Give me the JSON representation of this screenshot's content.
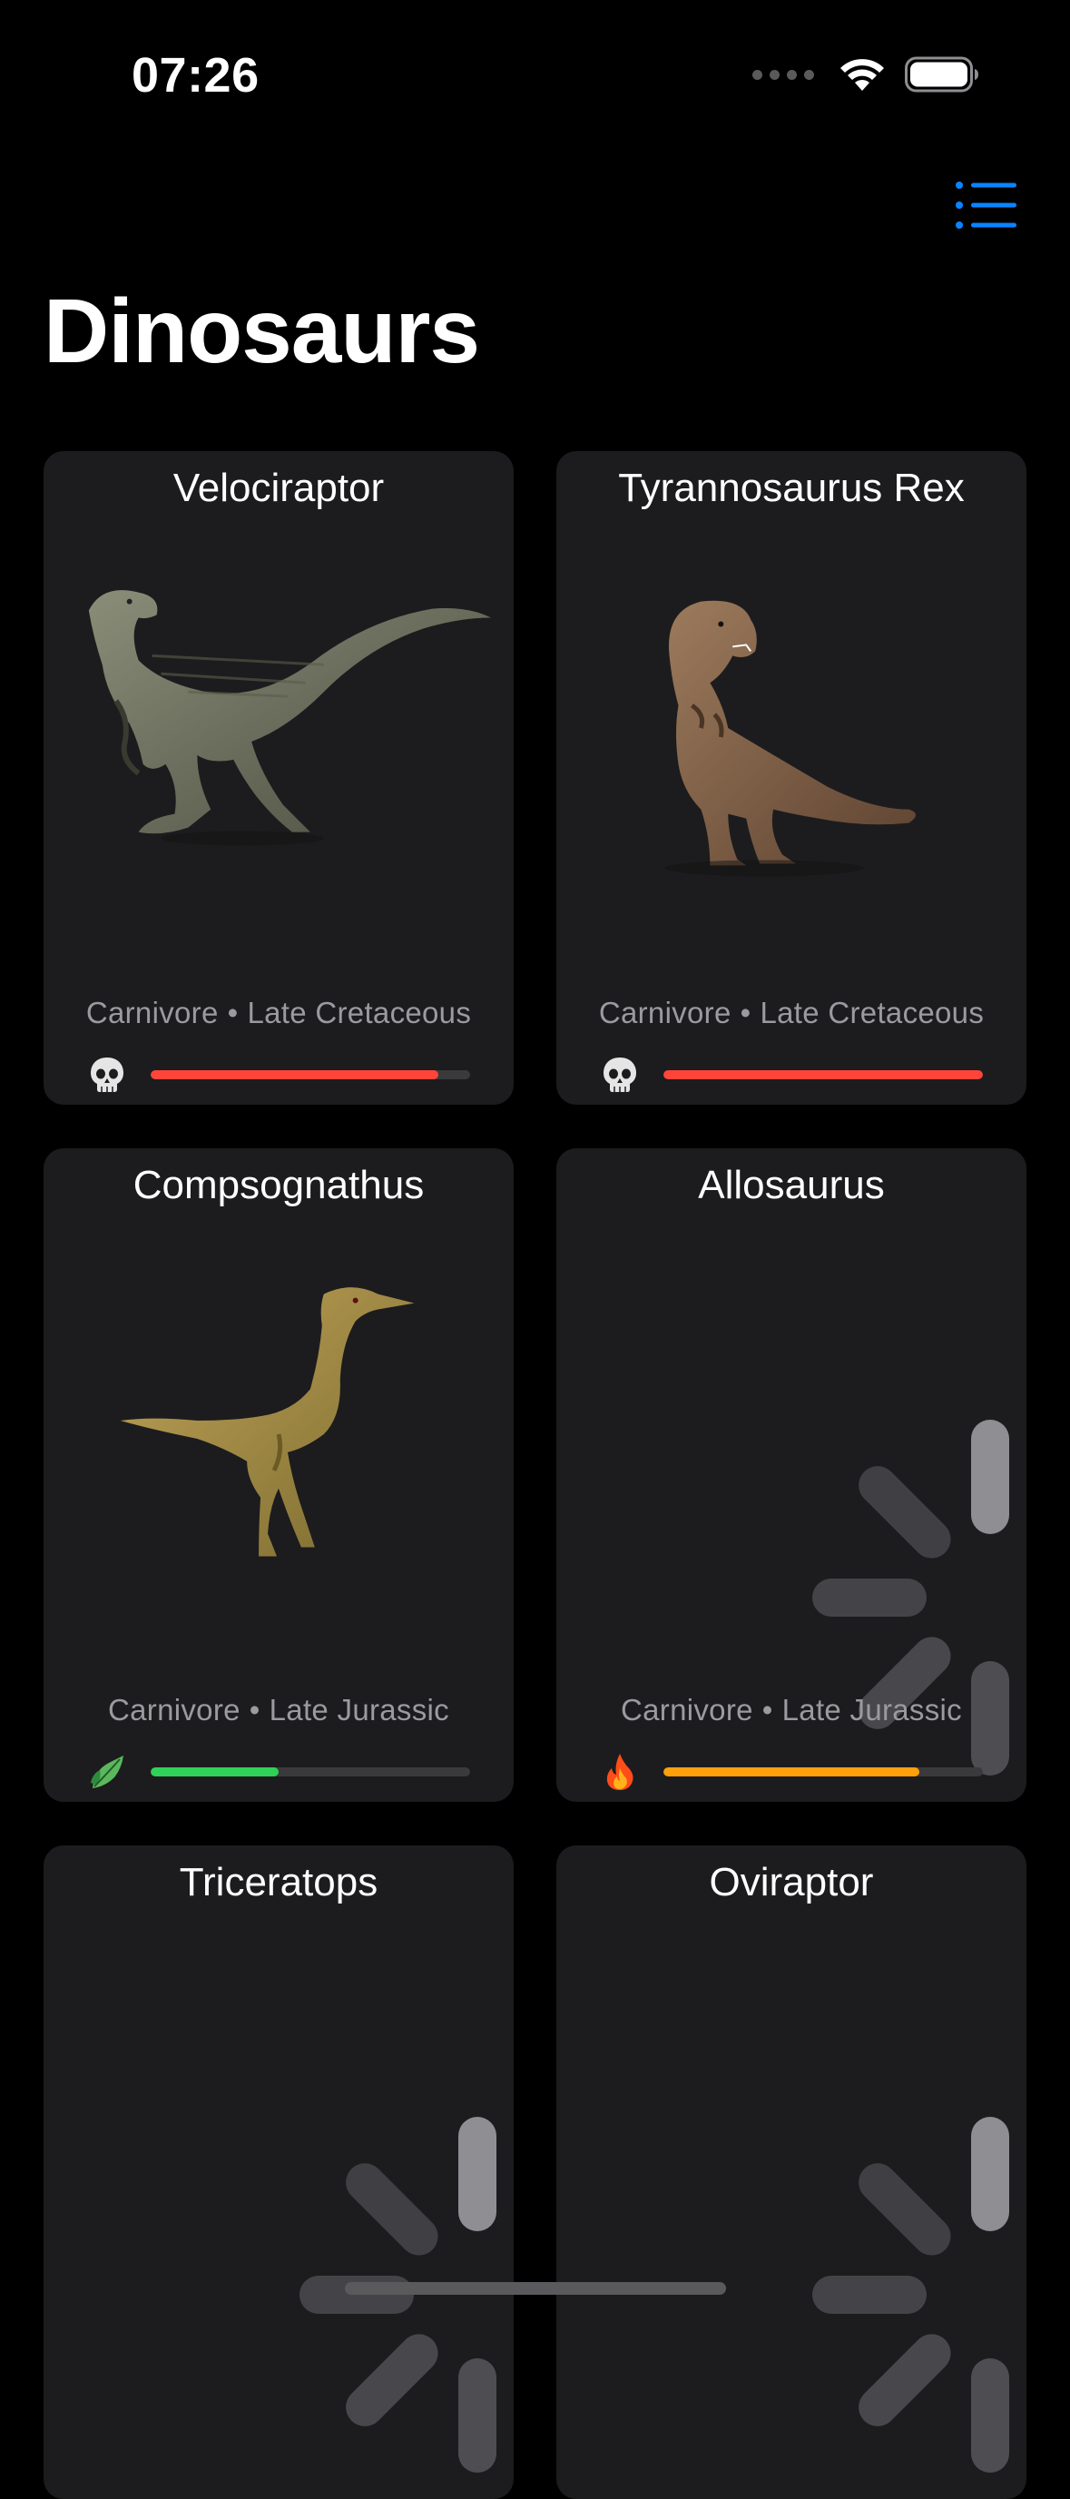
{
  "status_bar": {
    "time": "07:26"
  },
  "header": {
    "title": "Dinosaurs",
    "menu_icon": "list-icon",
    "accent_color": "#0a84ff"
  },
  "dinosaurs": [
    {
      "name": "Velociraptor",
      "diet": "Carnivore",
      "period": "Late Cretaceous",
      "status_icon": "skull-icon",
      "level": 0.9,
      "bar_color": "#ff453a",
      "image": "velociraptor-image"
    },
    {
      "name": "Tyrannosaurus Rex",
      "diet": "Carnivore",
      "period": "Late Cretaceous",
      "status_icon": "skull-icon",
      "level": 1.0,
      "bar_color": "#ff453a",
      "image": "trex-image"
    },
    {
      "name": "Compsognathus",
      "diet": "Carnivore",
      "period": "Late Jurassic",
      "status_icon": "leaf-icon",
      "level": 0.4,
      "bar_color": "#30d158",
      "image": "compsognathus-image"
    },
    {
      "name": "Allosaurus",
      "diet": "Carnivore",
      "period": "Late Jurassic",
      "status_icon": "fire-icon",
      "level": 0.8,
      "bar_color": "#ff9f0a",
      "image": "loading-spinner"
    },
    {
      "name": "Triceratops",
      "image": "loading-spinner"
    },
    {
      "name": "Oviraptor",
      "image": "loading-spinner"
    }
  ],
  "separator": "•"
}
